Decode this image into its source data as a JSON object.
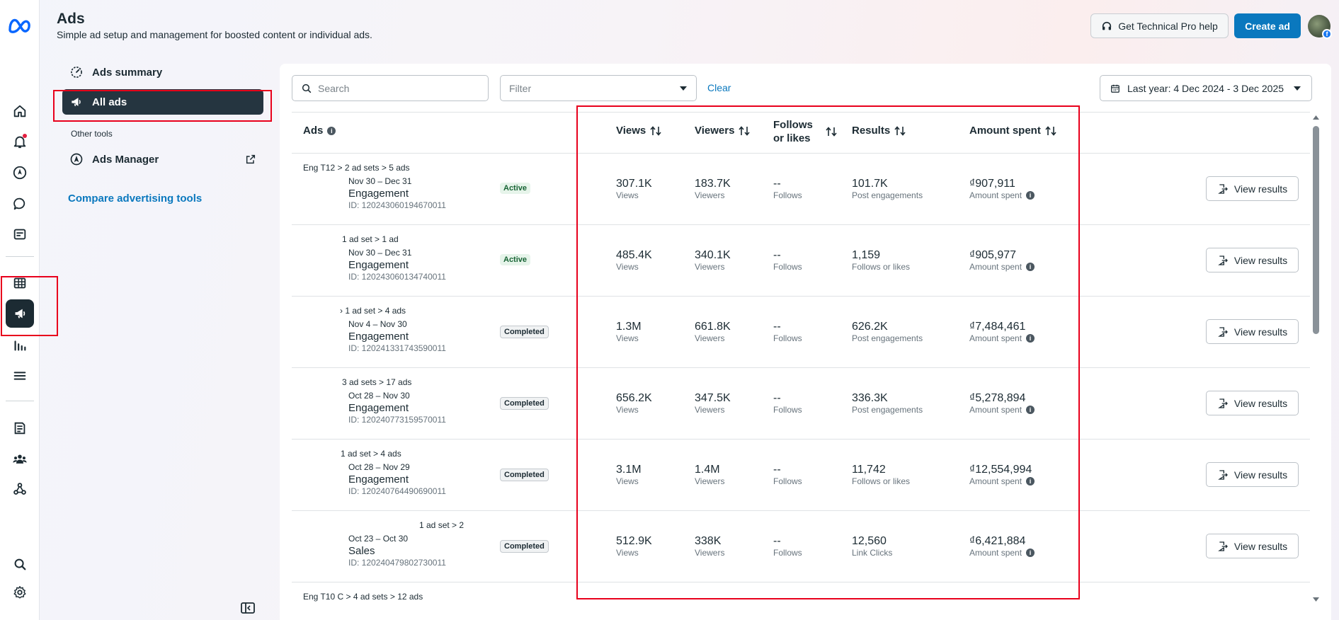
{
  "header": {
    "title": "Ads",
    "subtitle": "Simple ad setup and management for boosted content or individual ads.",
    "help_label": "Get Technical Pro help",
    "create_label": "Create ad"
  },
  "subnav": {
    "summary": "Ads summary",
    "all_ads": "All ads",
    "other_tools": "Other tools",
    "ads_manager": "Ads Manager",
    "compare": "Compare advertising tools"
  },
  "toolbar": {
    "search_placeholder": "Search",
    "filter_placeholder": "Filter",
    "clear": "Clear",
    "date_range": "Last year: 4 Dec 2024 - 3 Dec 2025"
  },
  "table": {
    "headers": {
      "ads": "Ads",
      "views": "Views",
      "viewers": "Viewers",
      "follows_1": "Follows",
      "follows_2": "or likes",
      "results": "Results",
      "amount": "Amount spent"
    },
    "view_results_label": "View results",
    "rows": [
      {
        "path": "Eng T12 > 2 ad sets > 5 ads",
        "dates": "Nov 30 – Dec 31",
        "objective": "Engagement",
        "id": "ID: 120243060194670011",
        "status": "Active",
        "views": "307.1K",
        "views_sub": "Views",
        "viewers": "183.7K",
        "viewers_sub": "Viewers",
        "follows": "--",
        "follows_sub": "Follows",
        "results": "101.7K",
        "results_sub": "Post engagements",
        "amount": "₫907,911",
        "amount_sub": "Amount spent"
      },
      {
        "path": "1 ad set > 1 ad",
        "dates": "Nov 30 – Dec 31",
        "objective": "Engagement",
        "id": "ID: 120243060134740011",
        "status": "Active",
        "views": "485.4K",
        "views_sub": "Views",
        "viewers": "340.1K",
        "viewers_sub": "Viewers",
        "follows": "--",
        "follows_sub": "Follows",
        "results": "1,159",
        "results_sub": "Follows or likes",
        "amount": "₫905,977",
        "amount_sub": "Amount spent"
      },
      {
        "path": "› 1 ad set > 4 ads",
        "dates": "Nov 4 – Nov 30",
        "objective": "Engagement",
        "id": "ID: 120241331743590011",
        "status": "Completed",
        "views": "1.3M",
        "views_sub": "Views",
        "viewers": "661.8K",
        "viewers_sub": "Viewers",
        "follows": "--",
        "follows_sub": "Follows",
        "results": "626.2K",
        "results_sub": "Post engagements",
        "amount": "₫7,484,461",
        "amount_sub": "Amount spent"
      },
      {
        "path": "3 ad sets > 17 ads",
        "dates": "Oct 28 – Nov 30",
        "objective": "Engagement",
        "id": "ID: 120240773159570011",
        "status": "Completed",
        "views": "656.2K",
        "views_sub": "Views",
        "viewers": "347.5K",
        "viewers_sub": "Viewers",
        "follows": "--",
        "follows_sub": "Follows",
        "results": "336.3K",
        "results_sub": "Post engagements",
        "amount": "₫5,278,894",
        "amount_sub": "Amount spent"
      },
      {
        "path": "1 ad set > 4 ads",
        "dates": "Oct 28 – Nov 29",
        "objective": "Engagement",
        "id": "ID: 120240764490690011",
        "status": "Completed",
        "views": "3.1M",
        "views_sub": "Views",
        "viewers": "1.4M",
        "viewers_sub": "Viewers",
        "follows": "--",
        "follows_sub": "Follows",
        "results": "11,742",
        "results_sub": "Follows or likes",
        "amount": "₫12,554,994",
        "amount_sub": "Amount spent"
      },
      {
        "path": "1 ad set > 2",
        "dates": "Oct 23 – Oct 30",
        "objective": "Sales",
        "id": "ID: 120240479802730011",
        "status": "Completed",
        "views": "512.9K",
        "views_sub": "Views",
        "viewers": "338K",
        "viewers_sub": "Viewers",
        "follows": "--",
        "follows_sub": "Follows",
        "results": "12,560",
        "results_sub": "Link Clicks",
        "amount": "₫6,421,884",
        "amount_sub": "Amount spent"
      }
    ],
    "footer_path": "Eng T10 C > 4 ad sets > 12 ads"
  }
}
